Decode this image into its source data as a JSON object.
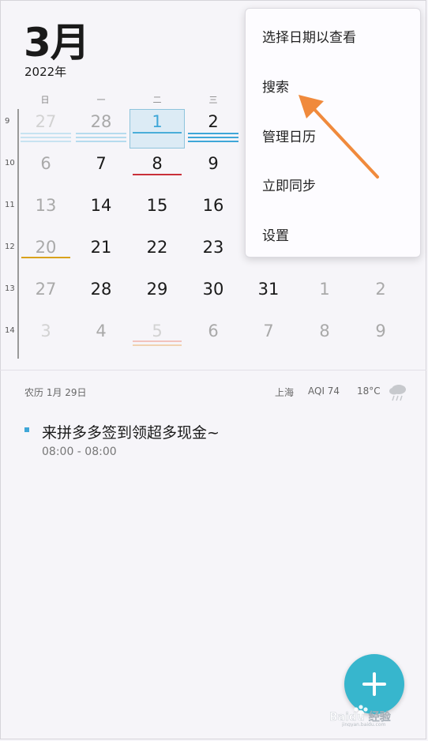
{
  "header": {
    "month": "3月",
    "year": "2022年"
  },
  "weekdays": [
    "日",
    "一",
    "二",
    "三"
  ],
  "week_numbers": [
    "9",
    "10",
    "11",
    "12",
    "13",
    "14"
  ],
  "calendar": {
    "rows": [
      [
        "27",
        "28",
        "1",
        "2"
      ],
      [
        "6",
        "7",
        "8",
        "9"
      ],
      [
        "13",
        "14",
        "15",
        "16"
      ],
      [
        "20",
        "21",
        "22",
        "23"
      ],
      [
        "27",
        "28",
        "29",
        "30",
        "31",
        "1",
        "2"
      ],
      [
        "3",
        "4",
        "5",
        "6",
        "7",
        "8",
        "9"
      ]
    ]
  },
  "info_bar": {
    "lunar": "农历 1月 29日",
    "city": "上海",
    "aqi": "AQI 74",
    "temperature": "18°C",
    "weather_icon": "rain-cloud-icon"
  },
  "event": {
    "title": "来拼多多签到领超多现金~",
    "time": "08:00 - 08:00"
  },
  "menu": {
    "items": [
      "选择日期以查看",
      "搜索",
      "管理日历",
      "立即同步",
      "设置"
    ]
  },
  "fab": {
    "icon": "plus-icon"
  },
  "watermark": {
    "text": "Baidu 经验",
    "subtext": "jingyan.baidu.com"
  },
  "colors": {
    "accent": "#37b6cd",
    "today": "#3fa7d8",
    "arrow": "#f08a3c",
    "event_red": "#c9303a",
    "event_gold": "#d9a21b"
  }
}
